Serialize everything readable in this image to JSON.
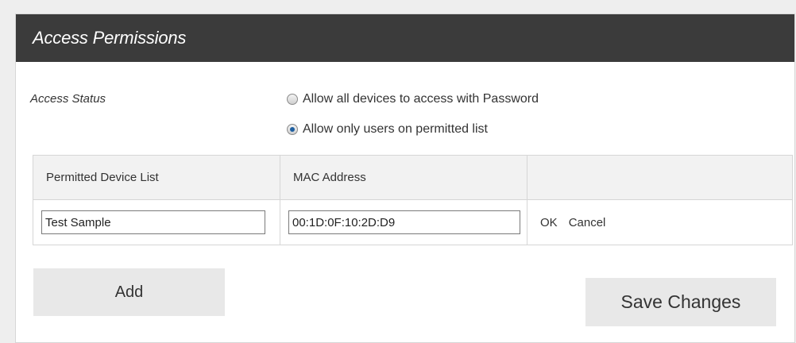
{
  "header": {
    "title": "Access Permissions"
  },
  "access": {
    "label": "Access Status",
    "options": [
      {
        "label": "Allow all devices to access with Password",
        "checked": false
      },
      {
        "label": "Allow only users on permitted list",
        "checked": true
      }
    ]
  },
  "table": {
    "headers": [
      "Permitted Device List",
      "MAC Address",
      ""
    ],
    "rows": [
      {
        "device_name": "Test Sample",
        "mac": "00:1D:0F:10:2D:D9",
        "ok_label": "OK",
        "cancel_label": "Cancel"
      }
    ]
  },
  "buttons": {
    "add": "Add",
    "save": "Save Changes"
  }
}
